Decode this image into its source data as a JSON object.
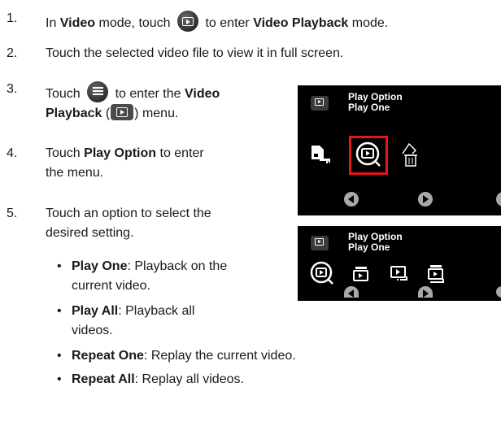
{
  "steps": [
    {
      "num": "1.",
      "pre": "In ",
      "b1": "Video",
      "mid1": " mode, touch ",
      "icon": "video-playback-circle-icon",
      "mid2": " to enter ",
      "b2": "Video Playback",
      "post": " mode."
    },
    {
      "num": "2.",
      "text": "Touch the selected video file to view it in full screen."
    },
    {
      "num": "3.",
      "pre": "Touch ",
      "icon": "menu-list-circle-icon",
      "mid": " to enter the ",
      "b1": "Video",
      "b2": "Playback",
      "paren_open": " (",
      "icon2": "video-playback-icon",
      "paren_close": ") menu."
    },
    {
      "num": "4.",
      "pre": "Touch ",
      "b1": "Play Option",
      "post": " to enter",
      "line2": "the menu."
    },
    {
      "num": "5.",
      "line1": "Touch an option to select the",
      "line2": "desired setting."
    }
  ],
  "options": [
    {
      "bullet": "•",
      "name": "Play One",
      "desc1": ": Playback on the",
      "desc2": "current video."
    },
    {
      "bullet": "•",
      "name": "Play All",
      "desc1": ": Playback all",
      "desc2": "videos."
    },
    {
      "bullet": "•",
      "name": "Repeat One",
      "desc1": ": Replay the current video."
    },
    {
      "bullet": "•",
      "name": "Repeat All",
      "desc1": ": Replay all videos."
    }
  ],
  "screen1": {
    "title": "Play Option",
    "value": "Play One",
    "selected_color": "#e8141c"
  },
  "screen2": {
    "title": "Play Option",
    "value": "Play One"
  }
}
